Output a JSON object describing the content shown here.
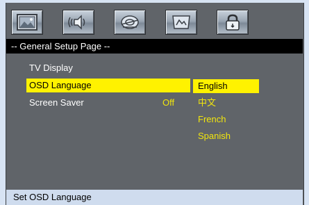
{
  "toolbar": {
    "buttons": [
      {
        "icon": "landscape-picture-icon"
      },
      {
        "icon": "audio-speaker-icon"
      },
      {
        "icon": "disc-icon"
      },
      {
        "icon": "picture-frame-icon"
      },
      {
        "icon": "lock-icon"
      }
    ]
  },
  "page_title": "-- General Setup Page --",
  "menu": {
    "items": [
      {
        "label": "TV Display",
        "value": ""
      },
      {
        "label": "OSD Language",
        "value": ""
      },
      {
        "label": "Screen Saver",
        "value": "Off"
      }
    ],
    "selected_index": 1
  },
  "language_options": {
    "items": [
      "English",
      "中文",
      "French",
      "Spanish"
    ],
    "selected_index": 0
  },
  "status": "Set OSD Language",
  "colors": {
    "panel": "#606469",
    "title_bar": "#000000",
    "highlight": "#fff200",
    "value_text": "#f2e60d",
    "status_bar": "#cfdcee"
  }
}
